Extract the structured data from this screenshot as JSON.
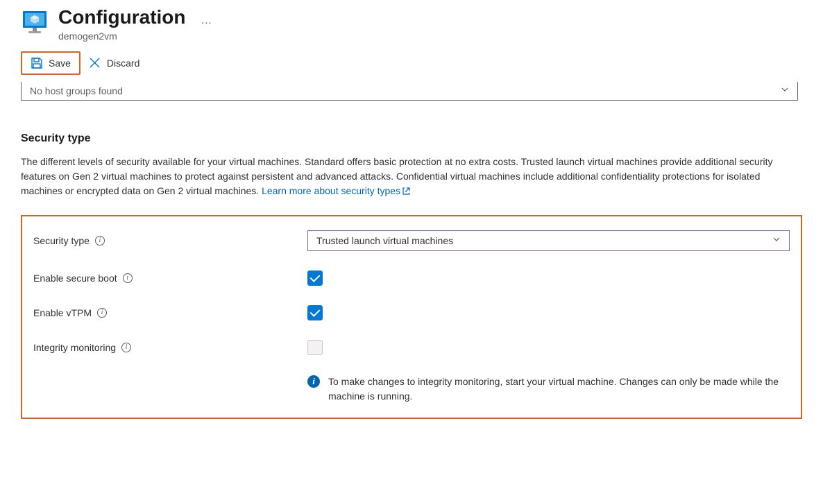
{
  "header": {
    "title": "Configuration",
    "subtitle": "demogen2vm"
  },
  "toolbar": {
    "save_label": "Save",
    "discard_label": "Discard"
  },
  "host_group": {
    "placeholder": "No host groups found"
  },
  "security": {
    "section_title": "Security type",
    "description": "The different levels of security available for your virtual machines. Standard offers basic protection at no extra costs. Trusted launch virtual machines provide additional security features on Gen 2 virtual machines to protect against persistent and advanced attacks. Confidential virtual machines include additional confidentiality protections for isolated machines or encrypted data on Gen 2 virtual machines. ",
    "link_text": "Learn more about security types",
    "fields": {
      "security_type": {
        "label": "Security type",
        "value": "Trusted launch virtual machines"
      },
      "secure_boot": {
        "label": "Enable secure boot",
        "checked": true
      },
      "vtpm": {
        "label": "Enable vTPM",
        "checked": true
      },
      "integrity": {
        "label": "Integrity monitoring",
        "checked": false
      }
    },
    "info_message": "To make changes to integrity monitoring, start your virtual machine. Changes can only be made while the machine is running."
  }
}
